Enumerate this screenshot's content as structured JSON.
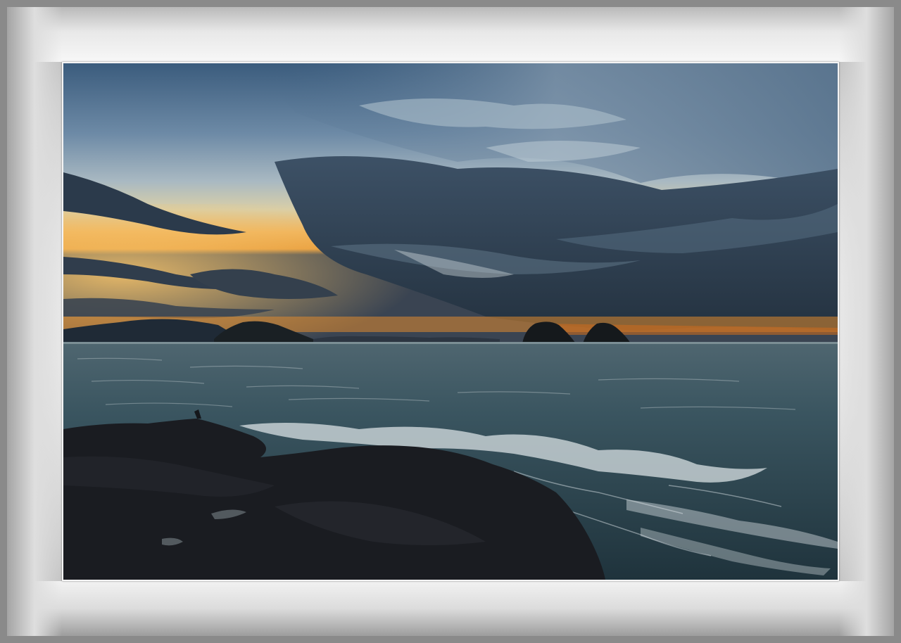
{
  "image": {
    "subject": "sunset-seascape",
    "colors": {
      "sky_top": "#3d5a78",
      "sky_horizon_glow": "#f2a33a",
      "cloud_dark": "#2a3a4c",
      "sea": "#2e4650",
      "rocks": "#1b1d22",
      "mat": "#f2f2f2",
      "frame": "#8a8a8a"
    }
  }
}
